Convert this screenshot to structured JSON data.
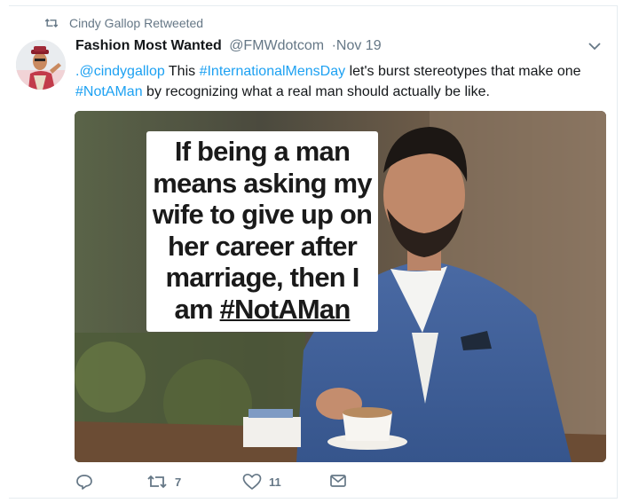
{
  "retweet_bar": {
    "icon": "retweet-icon",
    "user": "Cindy Gallop",
    "label": "Retweeted"
  },
  "tweet": {
    "author": {
      "name": "Fashion Most Wanted",
      "handle": "@FMWdotcom",
      "separator": "·",
      "date": "Nov 19",
      "avatar_icon": "avatar-photo"
    },
    "menu_icon": "chevron-down-icon",
    "text": {
      "mention": ".@cindygallop",
      "part1": " This ",
      "hashtag1": "#InternationalMensDay",
      "part2": " let's burst stereotypes that make one ",
      "hashtag2": "#NotAMan",
      "part3": " by recognizing what a real man should actually be like."
    },
    "media": {
      "quote_lines": [
        "If being a man",
        "means asking my",
        "wife to give up on",
        "her career after",
        "marriage, then I"
      ],
      "quote_last_prefix": "am ",
      "quote_last_tag": "#NotAMan"
    },
    "actions": {
      "reply": {
        "icon": "reply-icon",
        "count": ""
      },
      "retweet": {
        "icon": "retweet-icon",
        "count": "7"
      },
      "like": {
        "icon": "heart-icon",
        "count": "11"
      },
      "message": {
        "icon": "envelope-icon",
        "count": ""
      }
    }
  },
  "colors": {
    "link": "#1da1f2",
    "secondary_text": "#657786",
    "primary_text": "#14171a",
    "suit_blue": "#3f5f97"
  }
}
